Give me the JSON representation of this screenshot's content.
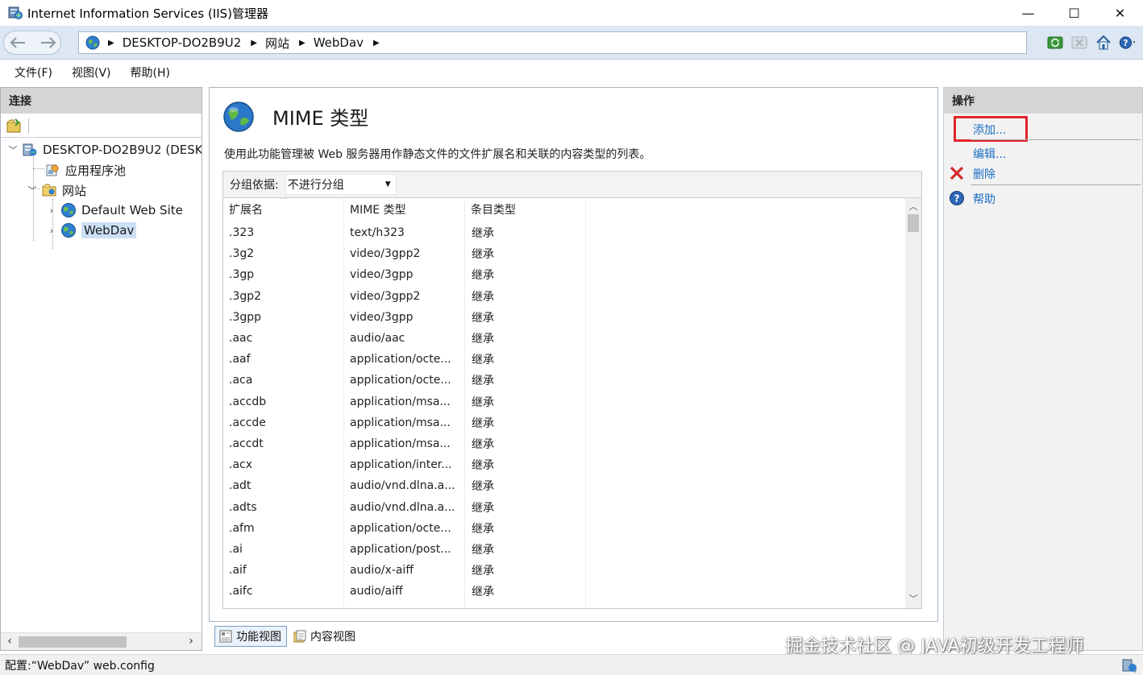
{
  "window": {
    "title": "Internet Information Services (IIS)管理器",
    "minimize_glyph": "—",
    "maximize_glyph": "☐",
    "close_glyph": "✕"
  },
  "address_bar": {
    "breadcrumbs": [
      "DESKTOP-DO2B9U2",
      "网站",
      "WebDav"
    ],
    "separator": "▶"
  },
  "menu": [
    "文件(F)",
    "视图(V)",
    "帮助(H)"
  ],
  "connections": {
    "header": "连接",
    "tree": {
      "server": "DESKTOP-DO2B9U2 (DESK",
      "app_pools": "应用程序池",
      "sites": "网站",
      "default_site": "Default Web Site",
      "webdav": "WebDav"
    }
  },
  "feature": {
    "title": "MIME 类型",
    "description": "使用此功能管理被 Web 服务器用作静态文件的文件扩展名和关联的内容类型的列表。",
    "group_by_label": "分组依据:",
    "group_by_value": "不进行分组",
    "columns": [
      "扩展名",
      "MIME 类型",
      "条目类型"
    ],
    "rows": [
      [
        ".323",
        "text/h323",
        "继承"
      ],
      [
        ".3g2",
        "video/3gpp2",
        "继承"
      ],
      [
        ".3gp",
        "video/3gpp",
        "继承"
      ],
      [
        ".3gp2",
        "video/3gpp2",
        "继承"
      ],
      [
        ".3gpp",
        "video/3gpp",
        "继承"
      ],
      [
        ".aac",
        "audio/aac",
        "继承"
      ],
      [
        ".aaf",
        "application/octe...",
        "继承"
      ],
      [
        ".aca",
        "application/octe...",
        "继承"
      ],
      [
        ".accdb",
        "application/msa...",
        "继承"
      ],
      [
        ".accde",
        "application/msa...",
        "继承"
      ],
      [
        ".accdt",
        "application/msa...",
        "继承"
      ],
      [
        ".acx",
        "application/inter...",
        "继承"
      ],
      [
        ".adt",
        "audio/vnd.dlna.a...",
        "继承"
      ],
      [
        ".adts",
        "audio/vnd.dlna.a...",
        "继承"
      ],
      [
        ".afm",
        "application/octe...",
        "继承"
      ],
      [
        ".ai",
        "application/post...",
        "继承"
      ],
      [
        ".aif",
        "audio/x-aiff",
        "继承"
      ],
      [
        ".aifc",
        "audio/aiff",
        "继承"
      ]
    ]
  },
  "view_tabs": {
    "features": "功能视图",
    "content": "内容视图"
  },
  "actions": {
    "header": "操作",
    "add": "添加...",
    "edit": "编辑...",
    "delete": "删除",
    "help": "帮助"
  },
  "status": {
    "text": "配置:“WebDav” web.config"
  },
  "watermark": "掘金技术社区 @ JAVA初级开发工程师",
  "colors": {
    "highlight_box": "#e3242b",
    "action_link": "#1a6fc1",
    "address_bar_bg": "#dce7f3"
  }
}
